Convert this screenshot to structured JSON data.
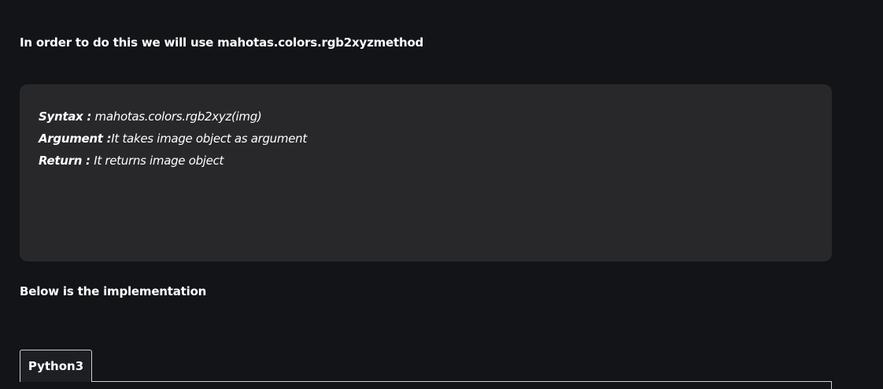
{
  "intro": {
    "text": "In order to do this we will use mahotas.colors.rgb2xyzmethod"
  },
  "syntax_box": {
    "lines": [
      {
        "key": "Syntax :",
        "value": " mahotas.colors.rgb2xyz(img)"
      },
      {
        "key": "Argument :",
        "value": "It takes image object as argument"
      },
      {
        "key": "Return :",
        "value": " It returns image object"
      }
    ]
  },
  "below": {
    "text": "Below is the implementation"
  },
  "code_tabs": [
    {
      "label": "Python3",
      "active": true
    }
  ],
  "colors": {
    "page_background": "#131418",
    "syntax_box_background": "#28282b",
    "text": "#ffffff",
    "tab_border": "#d0d0d0"
  }
}
